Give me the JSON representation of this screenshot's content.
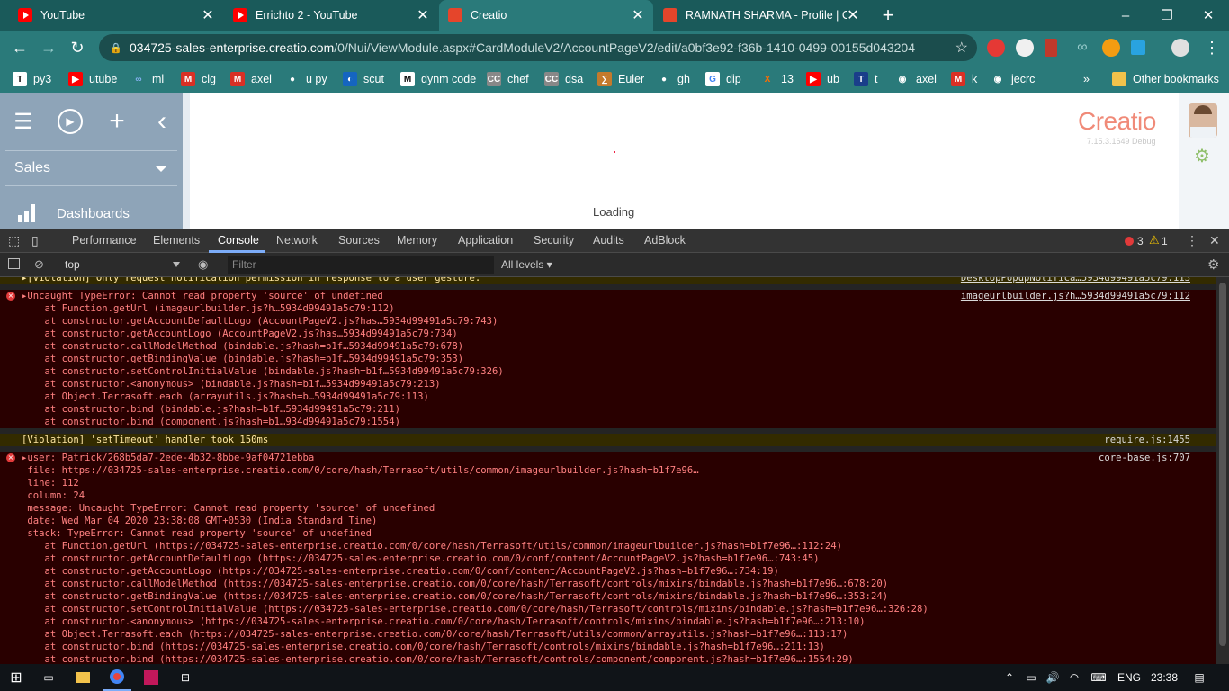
{
  "browser": {
    "tabs": [
      {
        "label": "YouTube",
        "icon": "youtube-icon"
      },
      {
        "label": "Errichto 2 - YouTube",
        "icon": "youtube-icon"
      },
      {
        "label": "Creatio",
        "icon": "creatio-icon"
      },
      {
        "label": "RAMNATH SHARMA - Profile | Co",
        "icon": "creatio-icon"
      }
    ],
    "new_tab": "+",
    "window": {
      "minimize": "–",
      "maximize": "❐",
      "close": "✕"
    },
    "url_host": "034725-sales-enterprise.creatio.com",
    "url_path": "/0/Nui/ViewModule.aspx#CardModuleV2/AccountPageV2/edit/a0bf3e92-f36b-1410-0499-00155d043204",
    "bookmarks": [
      {
        "label": "py3",
        "icon": "T",
        "color": "#ffffff",
        "fg": "#000000"
      },
      {
        "label": "utube",
        "icon": "▶",
        "color": "#ff0000",
        "fg": "#ffffff"
      },
      {
        "label": "ml",
        "icon": "∞",
        "color": "#2a7a7a",
        "fg": "#8ab4f8"
      },
      {
        "label": "clg",
        "icon": "M",
        "color": "#d93025",
        "fg": "#ffffff"
      },
      {
        "label": "axel",
        "icon": "M",
        "color": "#d93025",
        "fg": "#ffffff"
      },
      {
        "label": "u py",
        "icon": "●",
        "color": "#2a7a7a",
        "fg": "#ffffff"
      },
      {
        "label": "scut",
        "icon": "◐",
        "color": "#1565c0",
        "fg": "#ffffff"
      },
      {
        "label": "dynm code",
        "icon": "M",
        "color": "#ffffff",
        "fg": "#000000"
      },
      {
        "label": "chef",
        "icon": "CC",
        "color": "#888888",
        "fg": "#ffffff"
      },
      {
        "label": "dsa",
        "icon": "CC",
        "color": "#888888",
        "fg": "#ffffff"
      },
      {
        "label": "Euler",
        "icon": "∑",
        "color": "#c47a2c",
        "fg": "#ffffff"
      },
      {
        "label": "gh",
        "icon": "●",
        "color": "#2a7a7a",
        "fg": "#ffffff"
      },
      {
        "label": "dip",
        "icon": "G",
        "color": "#ffffff",
        "fg": "#4285f4"
      },
      {
        "label": "13",
        "icon": "X",
        "color": "#2a7a7a",
        "fg": "#ff6d00"
      },
      {
        "label": "ub",
        "icon": "▶",
        "color": "#ff0000",
        "fg": "#ffffff"
      },
      {
        "label": "t",
        "icon": "T",
        "color": "#1a3e8a",
        "fg": "#ffffff"
      },
      {
        "label": "axel",
        "icon": "◉",
        "color": "#2a7a7a",
        "fg": "#ffffff"
      },
      {
        "label": "k",
        "icon": "M",
        "color": "#d93025",
        "fg": "#ffffff"
      },
      {
        "label": "jecrc",
        "icon": "◉",
        "color": "#2a7a7a",
        "fg": "#ffffff"
      }
    ],
    "more_bookmarks": "»",
    "other_bookmarks": "Other bookmarks"
  },
  "app": {
    "section": "Sales",
    "menu_item": "Dashboards",
    "logo": "Creatio",
    "version": "7.15.3.1649 Debug",
    "loading": "Loading"
  },
  "devtools": {
    "tabs": [
      "Performance",
      "Elements",
      "Console",
      "Network",
      "Sources",
      "Memory",
      "Application",
      "Security",
      "Audits",
      "AdBlock"
    ],
    "active_tab": "Console",
    "error_count": "3",
    "warning_count": "1",
    "context": "top",
    "filter_placeholder": "Filter",
    "levels": "All levels ▾",
    "lines": [
      {
        "type": "warn",
        "text": "▸[Violation] Only request notification permission in response to a user gesture.",
        "src": "DesktopPopupNotifica…5934d99491a5c79:113",
        "icon": false
      },
      {
        "type": "err",
        "text": "▸Uncaught TypeError: Cannot read property 'source' of undefined",
        "src": "imageurlbuilder.js?h…5934d99491a5c79:112",
        "icon": true
      },
      {
        "type": "err",
        "text": "    at Function.getUrl (imageurlbuilder.js?h…5934d99491a5c79:112)",
        "src": "",
        "icon": false
      },
      {
        "type": "err",
        "text": "    at constructor.getAccountDefaultLogo (AccountPageV2.js?has…5934d99491a5c79:743)",
        "src": "",
        "icon": false
      },
      {
        "type": "err",
        "text": "    at constructor.getAccountLogo (AccountPageV2.js?has…5934d99491a5c79:734)",
        "src": "",
        "icon": false
      },
      {
        "type": "err",
        "text": "    at constructor.callModelMethod (bindable.js?hash=b1f…5934d99491a5c79:678)",
        "src": "",
        "icon": false
      },
      {
        "type": "err",
        "text": "    at constructor.getBindingValue (bindable.js?hash=b1f…5934d99491a5c79:353)",
        "src": "",
        "icon": false
      },
      {
        "type": "err",
        "text": "    at constructor.setControlInitialValue (bindable.js?hash=b1f…5934d99491a5c79:326)",
        "src": "",
        "icon": false
      },
      {
        "type": "err",
        "text": "    at constructor.<anonymous> (bindable.js?hash=b1f…5934d99491a5c79:213)",
        "src": "",
        "icon": false
      },
      {
        "type": "err",
        "text": "    at Object.Terrasoft.each (arrayutils.js?hash=b…5934d99491a5c79:113)",
        "src": "",
        "icon": false
      },
      {
        "type": "err",
        "text": "    at constructor.bind (bindable.js?hash=b1f…5934d99491a5c79:211)",
        "src": "",
        "icon": false
      },
      {
        "type": "err",
        "text": "    at constructor.bind (component.js?hash=b1…934d99491a5c79:1554)",
        "src": "",
        "icon": false
      },
      {
        "type": "warn",
        "text": "[Violation] 'setTimeout' handler took 150ms",
        "src": "require.js:1455",
        "icon": false
      },
      {
        "type": "err",
        "text": "▸user: Patrick/268b5da7-2ede-4b32-8bbe-9af04721ebba",
        "src": "core-base.js:707",
        "icon": true
      },
      {
        "type": "err",
        "text": " file: https://034725-sales-enterprise.creatio.com/0/core/hash/Terrasoft/utils/common/imageurlbuilder.js?hash=b1f7e96…",
        "src": "",
        "icon": false
      },
      {
        "type": "err",
        "text": " line: 112",
        "src": "",
        "icon": false
      },
      {
        "type": "err",
        "text": " column: 24",
        "src": "",
        "icon": false
      },
      {
        "type": "err",
        "text": " message: Uncaught TypeError: Cannot read property 'source' of undefined",
        "src": "",
        "icon": false
      },
      {
        "type": "err",
        "text": " date: Wed Mar 04 2020 23:38:08 GMT+0530 (India Standard Time)",
        "src": "",
        "icon": false
      },
      {
        "type": "err",
        "text": " stack: TypeError: Cannot read property 'source' of undefined",
        "src": "",
        "icon": false
      },
      {
        "type": "err",
        "text": "    at Function.getUrl (https://034725-sales-enterprise.creatio.com/0/core/hash/Terrasoft/utils/common/imageurlbuilder.js?hash=b1f7e96…:112:24)",
        "src": "",
        "icon": false
      },
      {
        "type": "err",
        "text": "    at constructor.getAccountDefaultLogo (https://034725-sales-enterprise.creatio.com/0/conf/content/AccountPageV2.js?hash=b1f7e96…:743:45)",
        "src": "",
        "icon": false
      },
      {
        "type": "err",
        "text": "    at constructor.getAccountLogo (https://034725-sales-enterprise.creatio.com/0/conf/content/AccountPageV2.js?hash=b1f7e96…:734:19)",
        "src": "",
        "icon": false
      },
      {
        "type": "err",
        "text": "    at constructor.callModelMethod (https://034725-sales-enterprise.creatio.com/0/core/hash/Terrasoft/controls/mixins/bindable.js?hash=b1f7e96…:678:20)",
        "src": "",
        "icon": false
      },
      {
        "type": "err",
        "text": "    at constructor.getBindingValue (https://034725-sales-enterprise.creatio.com/0/core/hash/Terrasoft/controls/mixins/bindable.js?hash=b1f7e96…:353:24)",
        "src": "",
        "icon": false
      },
      {
        "type": "err",
        "text": "    at constructor.setControlInitialValue (https://034725-sales-enterprise.creatio.com/0/core/hash/Terrasoft/controls/mixins/bindable.js?hash=b1f7e96…:326:28)",
        "src": "",
        "icon": false
      },
      {
        "type": "err",
        "text": "    at constructor.<anonymous> (https://034725-sales-enterprise.creatio.com/0/core/hash/Terrasoft/controls/mixins/bindable.js?hash=b1f7e96…:213:10)",
        "src": "",
        "icon": false
      },
      {
        "type": "err",
        "text": "    at Object.Terrasoft.each (https://034725-sales-enterprise.creatio.com/0/core/hash/Terrasoft/utils/common/arrayutils.js?hash=b1f7e96…:113:17)",
        "src": "",
        "icon": false
      },
      {
        "type": "err",
        "text": "    at constructor.bind (https://034725-sales-enterprise.creatio.com/0/core/hash/Terrasoft/controls/mixins/bindable.js?hash=b1f7e96…:211:13)",
        "src": "",
        "icon": false
      },
      {
        "type": "err",
        "text": "    at constructor.bind (https://034725-sales-enterprise.creatio.com/0/core/hash/Terrasoft/controls/component/component.js?hash=b1f7e96…:1554:29)",
        "src": "",
        "icon": false
      }
    ]
  },
  "taskbar": {
    "lang": "ENG",
    "time": "23:38"
  }
}
